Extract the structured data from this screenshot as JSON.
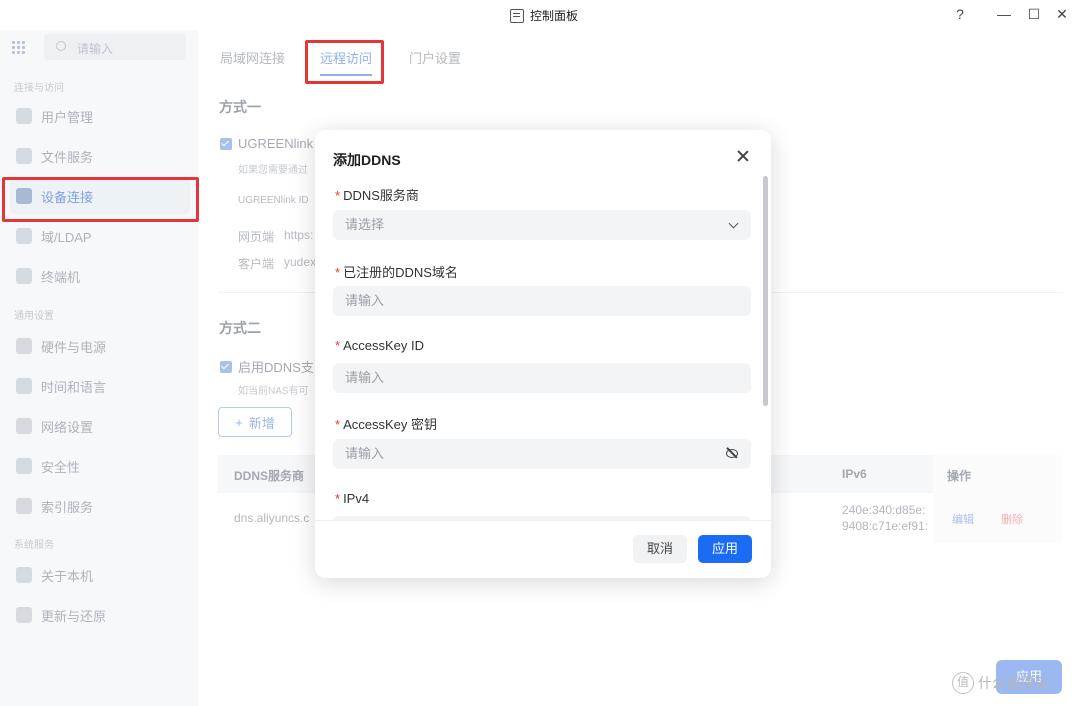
{
  "window": {
    "title": "控制面板",
    "buttons": [
      "?",
      "—",
      "☐",
      "✕"
    ]
  },
  "sidebar": {
    "search_placeholder": "请输入",
    "sections": [
      "连接与访问",
      "通用设置",
      "系统服务"
    ],
    "items": [
      {
        "label": "用户管理"
      },
      {
        "label": "文件服务"
      },
      {
        "label": "设备连接"
      },
      {
        "label": "域/LDAP"
      },
      {
        "label": "终端机"
      },
      {
        "label": "硬件与电源"
      },
      {
        "label": "时间和语言"
      },
      {
        "label": "网络设置"
      },
      {
        "label": "安全性"
      },
      {
        "label": "索引服务"
      },
      {
        "label": "关于本机"
      },
      {
        "label": "更新与还原"
      }
    ]
  },
  "main": {
    "tabs": [
      "局域网连接",
      "远程访问",
      "门户设置"
    ],
    "method1": {
      "heading": "方式一",
      "checkbox_label": "UGREENlink",
      "note": "如果您需要通过",
      "link_id_label": "UGREENlink ID",
      "web_label": "网页端",
      "web_value": "https:",
      "client_label": "客户端",
      "client_value": "yudex"
    },
    "method2": {
      "heading": "方式二",
      "checkbox_label": "启用DDNS支",
      "note": "如当前NAS有可"
    },
    "add_button": "新增",
    "add_icon": "+",
    "table": {
      "headers": [
        "DDNS服务商",
        "IPv6",
        "操作"
      ],
      "row": {
        "provider": "dns.aliyuncs.c",
        "ipv6_line1": "240e:340:d85e:",
        "ipv6_line2": "9408:c71e:ef91:",
        "edit": "编辑",
        "delete": "删除"
      }
    },
    "apply_button": "应用"
  },
  "dialog": {
    "title": "添加DDNS",
    "required_mark": "*",
    "fields": [
      {
        "label": "DDNS服务商",
        "placeholder": "请选择"
      },
      {
        "label": "已注册的DDNS域名",
        "placeholder": "请输入"
      },
      {
        "label": "AccessKey ID",
        "placeholder": "请输入"
      },
      {
        "label": "AccessKey 密钥",
        "placeholder": "请输入"
      },
      {
        "label": "IPv4",
        "placeholder": ""
      }
    ],
    "cancel": "取消",
    "apply": "应用"
  },
  "watermark": {
    "symbol": "值",
    "text": "什么值得买"
  },
  "colors": {
    "accent": "#1a6cf5",
    "highlight": "#e3353a"
  }
}
